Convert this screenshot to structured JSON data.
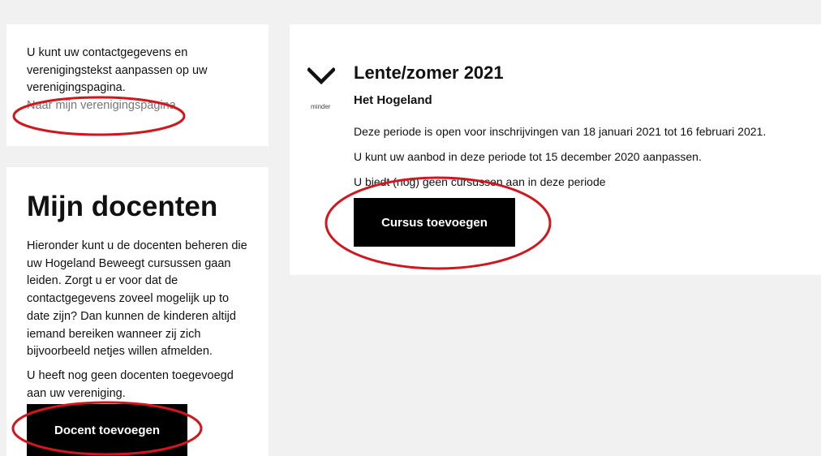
{
  "profile_card": {
    "text": "U kunt uw contactgegevens en verenigingstekst aanpassen op uw verenigingspagina.",
    "link": "Naar mijn verenigingspagina"
  },
  "teachers_card": {
    "title": "Mijn docenten",
    "description": "Hieronder kunt u de docenten beheren die uw Hogeland Beweegt cursussen gaan leiden. Zorgt u er voor dat de contactgegevens zoveel mogelijk up to date zijn? Dan kunnen de kinderen altijd iemand bereiken wanneer zij zich bijvoorbeeld netjes willen afmelden.",
    "empty_text": "U heeft nog geen docenten toegevoegd aan uw vereniging.",
    "add_button": "Docent toevoegen"
  },
  "period_card": {
    "collapse_label": "minder",
    "title": "Lente/zomer 2021",
    "subtitle": "Het Hogeland",
    "lines": [
      "Deze periode is open voor inschrijvingen van 18 januari 2021 tot 16 februari 2021.",
      "U kunt uw aanbod in deze periode tot 15 december 2020 aanpassen.",
      "U biedt (nog) geen cursussen aan in deze periode"
    ],
    "add_button": "Cursus toevoegen"
  },
  "colors": {
    "annotation": "#d0161e",
    "button_bg": "#000000",
    "page_bg": "#f1f1f1"
  }
}
